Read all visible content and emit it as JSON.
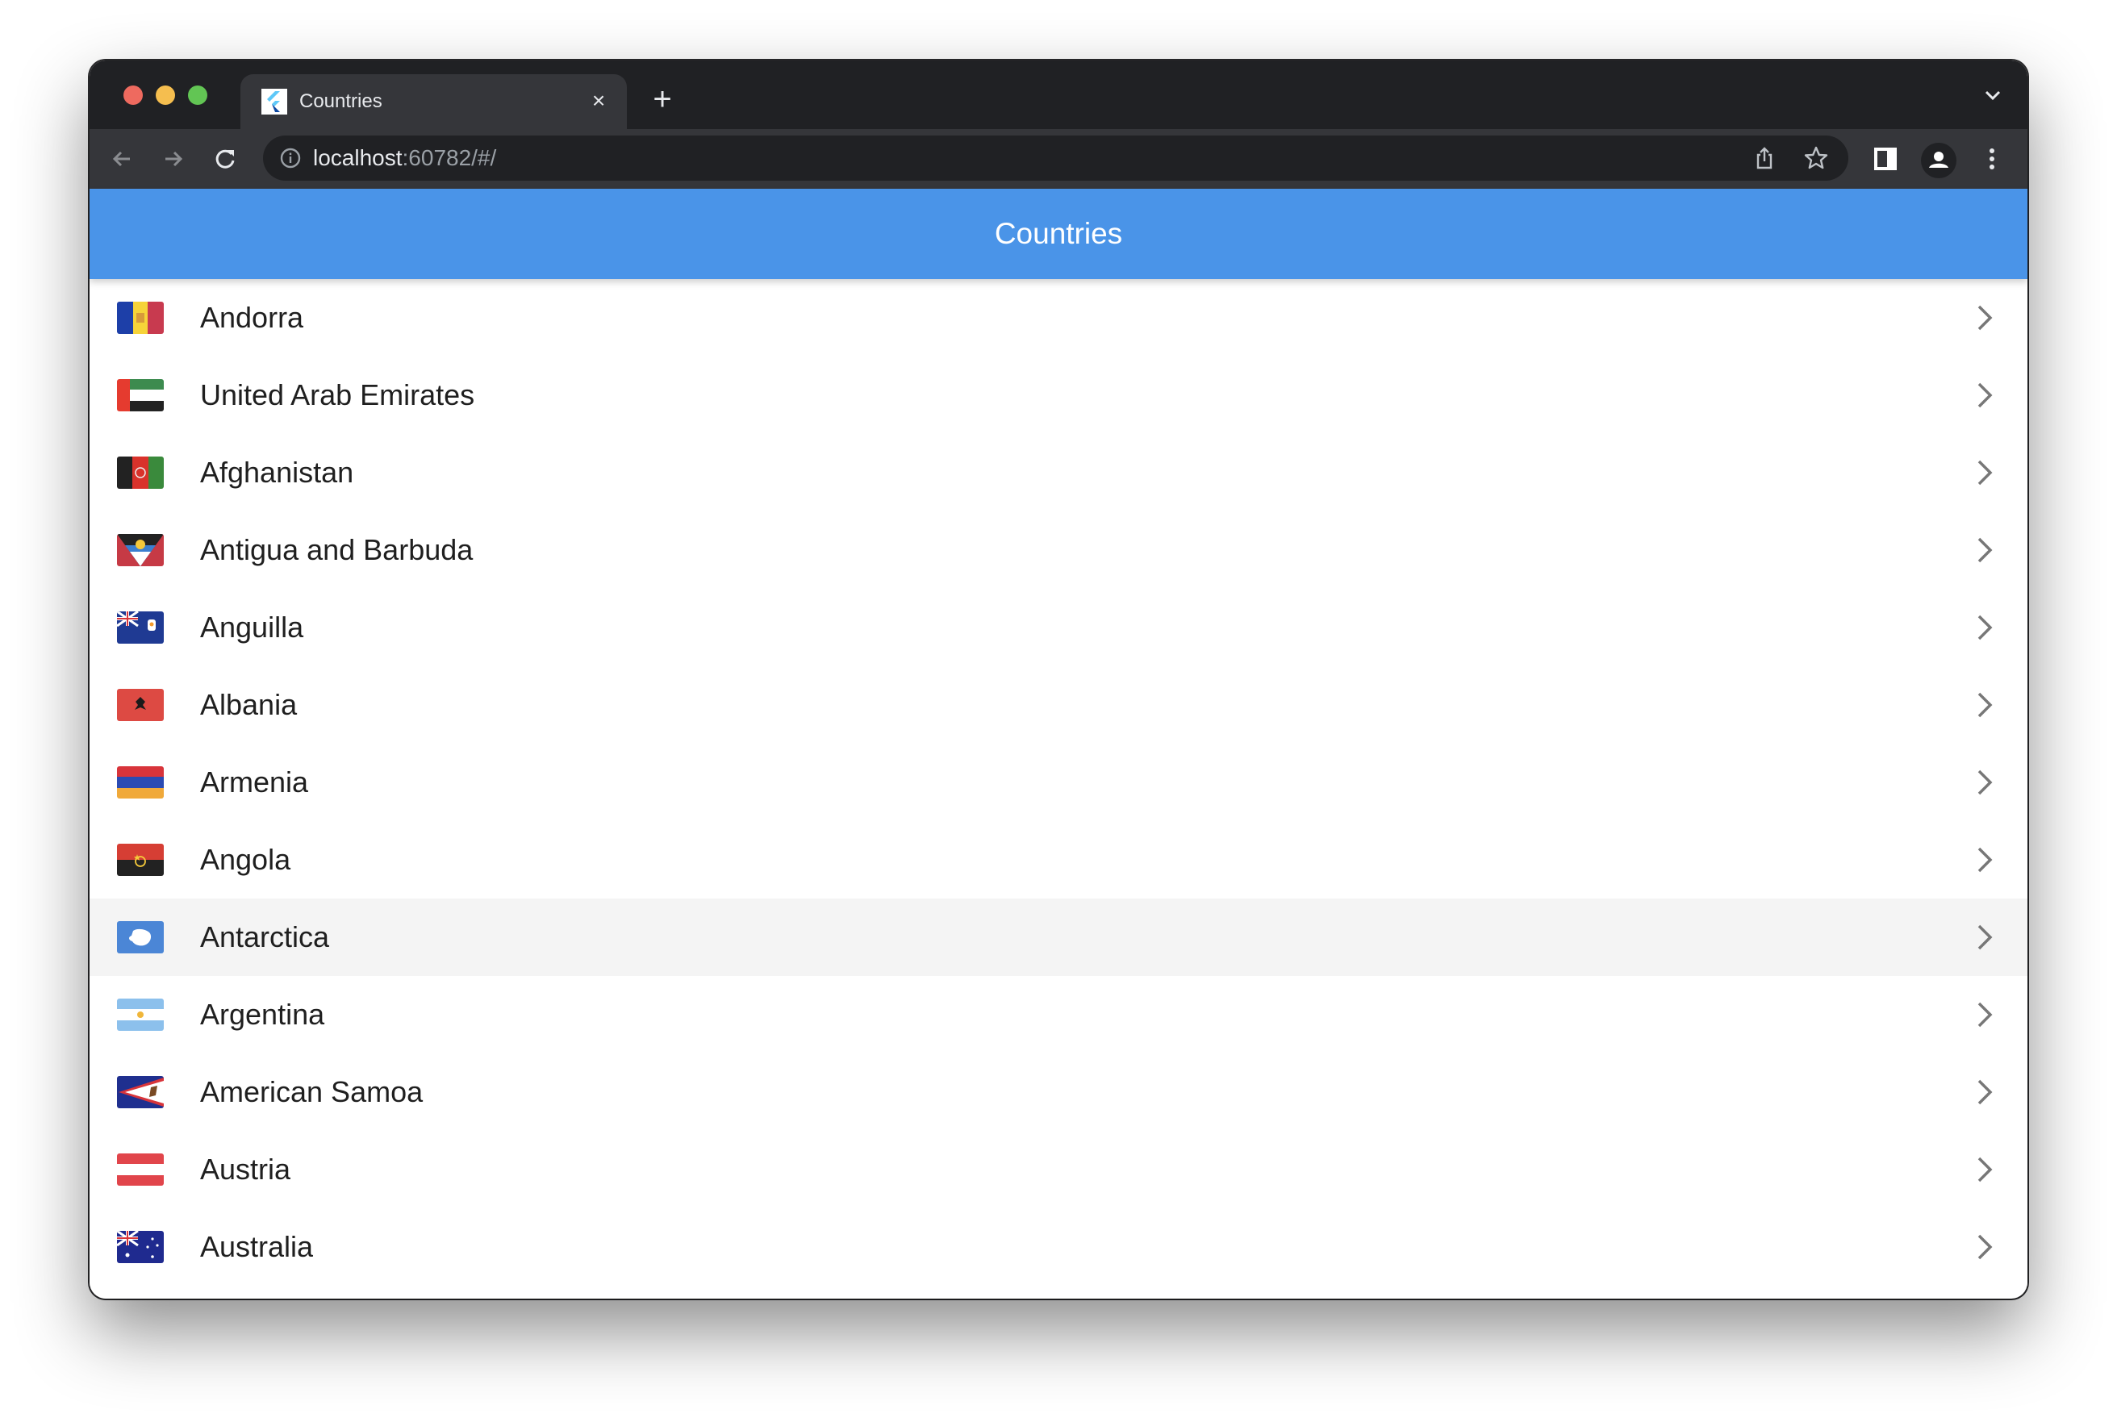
{
  "browser": {
    "tab": {
      "title": "Countries",
      "close_label": "×"
    },
    "new_tab_label": "+",
    "url": {
      "host": "localhost",
      "rest": ":60782/#/"
    },
    "icons": [
      "back-icon",
      "forward-icon",
      "reload-icon",
      "info-icon",
      "share-icon",
      "bookmark-star-icon",
      "side-panel-icon",
      "profile-icon",
      "more-menu-icon",
      "tab-search-chevron-icon"
    ]
  },
  "app": {
    "title": "Countries",
    "accent_color": "#4a94e8",
    "hovered_index": 8,
    "countries": [
      {
        "name": "Andorra",
        "flag": "andorra"
      },
      {
        "name": "United Arab Emirates",
        "flag": "uae"
      },
      {
        "name": "Afghanistan",
        "flag": "afghanistan"
      },
      {
        "name": "Antigua and Barbuda",
        "flag": "antigua"
      },
      {
        "name": "Anguilla",
        "flag": "anguilla"
      },
      {
        "name": "Albania",
        "flag": "albania"
      },
      {
        "name": "Armenia",
        "flag": "armenia"
      },
      {
        "name": "Angola",
        "flag": "angola"
      },
      {
        "name": "Antarctica",
        "flag": "antarctica"
      },
      {
        "name": "Argentina",
        "flag": "argentina"
      },
      {
        "name": "American Samoa",
        "flag": "american-samoa"
      },
      {
        "name": "Austria",
        "flag": "austria"
      },
      {
        "name": "Australia",
        "flag": "australia"
      }
    ]
  }
}
